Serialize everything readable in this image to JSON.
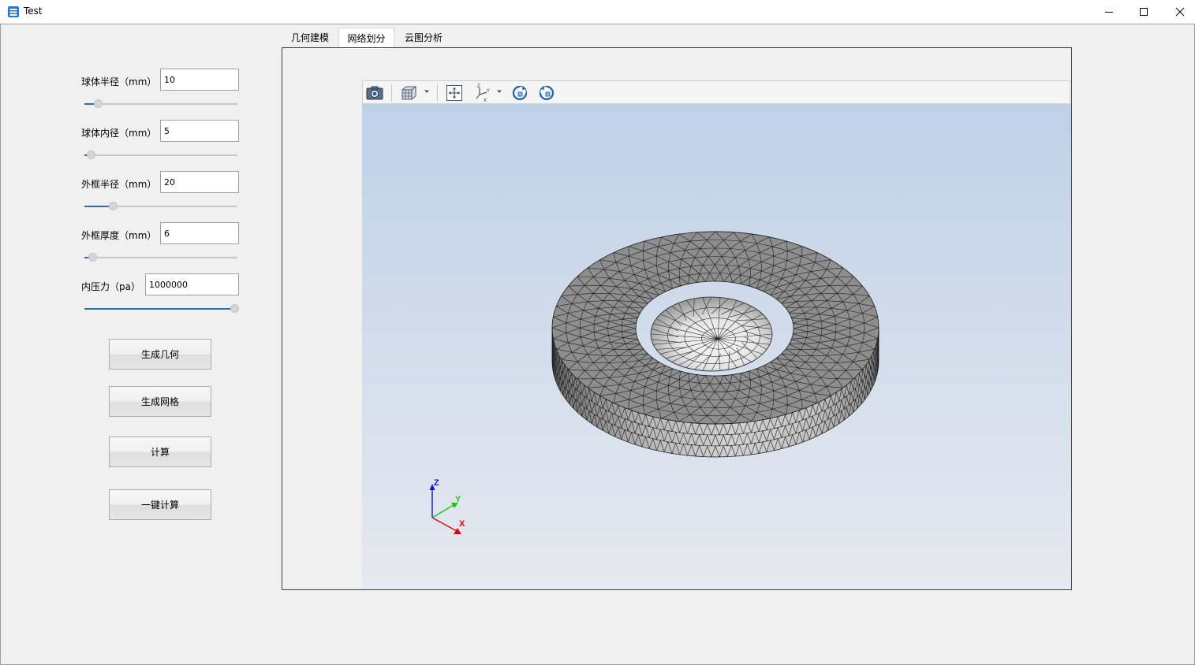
{
  "window": {
    "title": "Test",
    "buttons": {
      "minimize": "minimize",
      "maximize": "maximize",
      "close": "close"
    }
  },
  "params": [
    {
      "label": "球体半径（mm）",
      "value": "10",
      "slider_fraction": 0.09
    },
    {
      "label": "球体内径（mm）",
      "value": "5",
      "slider_fraction": 0.04
    },
    {
      "label": "外框半径（mm）",
      "value": "20",
      "slider_fraction": 0.19
    },
    {
      "label": "外框厚度（mm）",
      "value": "6",
      "slider_fraction": 0.05
    },
    {
      "label": "内压力（pa）",
      "value": "1000000",
      "slider_fraction": 1.0
    }
  ],
  "actions": {
    "generate_geometry": "生成几何",
    "generate_mesh": "生成网格",
    "compute": "计算",
    "one_click_compute": "一键计算"
  },
  "tabs": [
    {
      "label": "几何建模",
      "active": false
    },
    {
      "label": "网络划分",
      "active": true
    },
    {
      "label": "云图分析",
      "active": false
    }
  ],
  "viewer": {
    "toolbar_icons": [
      "camera-icon",
      "display-mode-cube-icon",
      "fit-all-icon",
      "axes-orientation-icon",
      "rotate-ccw-icon",
      "rotate-cw-icon"
    ],
    "axes": {
      "x": "X",
      "y": "Y",
      "z": "Z"
    },
    "colors": {
      "x": "#e3000f",
      "y": "#19c519",
      "z": "#0a18d6",
      "bg_top": "#bfd1e7",
      "bg_bottom": "#e6e9ef"
    }
  }
}
